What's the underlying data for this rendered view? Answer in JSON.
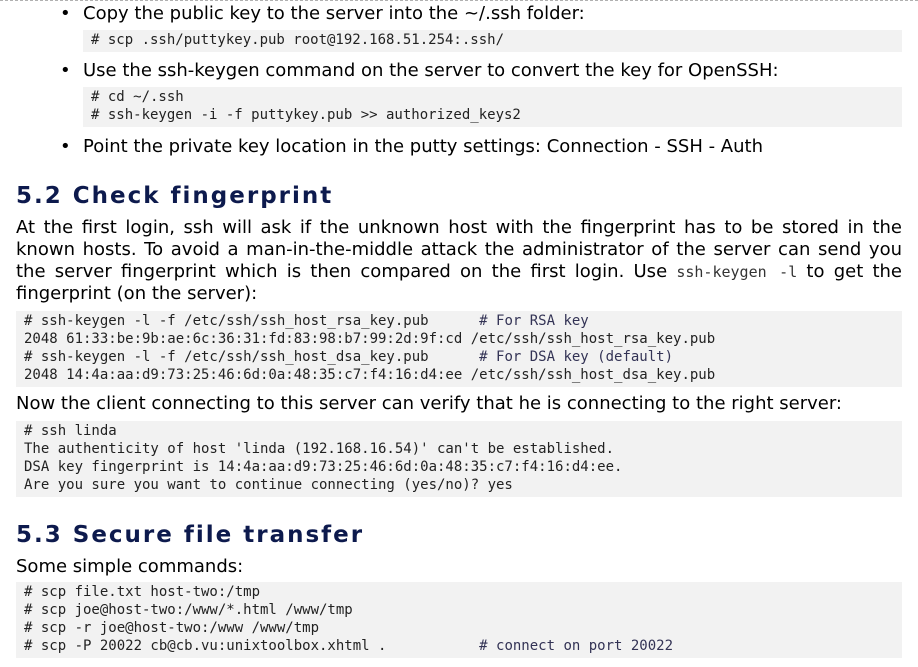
{
  "section51": {
    "items": [
      {
        "text": "Copy the public key to the server into the ~/.ssh folder:",
        "code": [
          "# scp .ssh/puttykey.pub root@192.168.51.254:.ssh/"
        ]
      },
      {
        "text": "Use the ssh-keygen command on the server to convert the key for OpenSSH:",
        "code": [
          "# cd ~/.ssh",
          "# ssh-keygen -i -f puttykey.pub >> authorized_keys2"
        ]
      },
      {
        "text": "Point the private key location in the putty settings: Connection - SSH - Auth"
      }
    ]
  },
  "section52": {
    "title": "5.2 Check fingerprint",
    "para1_before": "At the first login, ssh will ask if the unknown host with the fingerprint has to be stored in the known hosts. To avoid a man-in-the-middle attack the administrator of the server can send you the server fingerprint which is then compared on the first login. Use ",
    "para1_code": "ssh-keygen -l",
    "para1_after": " to get the fingerprint (on the server):",
    "code1": [
      {
        "cmd": "# ssh-keygen -l -f /etc/ssh/ssh_host_rsa_key.pub      ",
        "comment": "# For RSA key"
      },
      {
        "cmd": "2048 61:33:be:9b:ae:6c:36:31:fd:83:98:b7:99:2d:9f:cd /etc/ssh/ssh_host_rsa_key.pub",
        "comment": ""
      },
      {
        "cmd": "# ssh-keygen -l -f /etc/ssh/ssh_host_dsa_key.pub      ",
        "comment": "# For DSA key (default)"
      },
      {
        "cmd": "2048 14:4a:aa:d9:73:25:46:6d:0a:48:35:c7:f4:16:d4:ee /etc/ssh/ssh_host_dsa_key.pub",
        "comment": ""
      }
    ],
    "para2": "Now the client connecting to this server can verify that he is connecting to the right server:",
    "code2": [
      "# ssh linda",
      "The authenticity of host 'linda (192.168.16.54)' can't be established.",
      "DSA key fingerprint is 14:4a:aa:d9:73:25:46:6d:0a:48:35:c7:f4:16:d4:ee.",
      "Are you sure you want to continue connecting (yes/no)? yes"
    ]
  },
  "section53": {
    "title": "5.3 Secure file transfer",
    "intro": "Some simple commands:",
    "code": [
      {
        "cmd": "# scp file.txt host-two:/tmp",
        "comment": ""
      },
      {
        "cmd": "# scp joe@host-two:/www/*.html /www/tmp",
        "comment": ""
      },
      {
        "cmd": "# scp -r joe@host-two:/www /www/tmp",
        "comment": ""
      },
      {
        "cmd": "# scp -P 20022 cb@cb.vu:unixtoolbox.xhtml .           ",
        "comment": "# connect on port 20022"
      }
    ]
  }
}
